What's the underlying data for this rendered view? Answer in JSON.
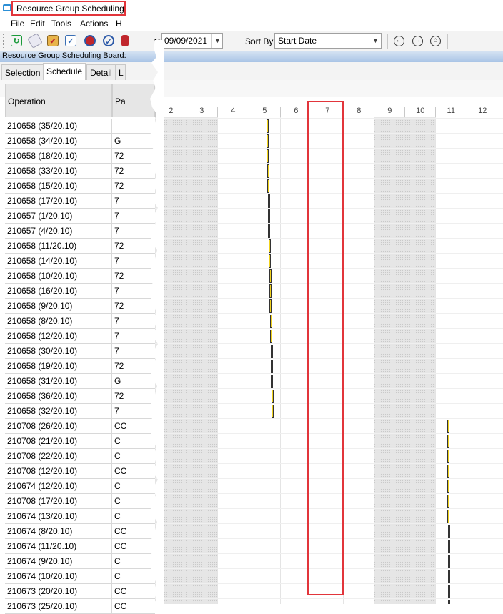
{
  "window": {
    "title": "Resource Group Scheduling Board"
  },
  "menu": [
    "File",
    "Edit",
    "Tools",
    "Actions",
    "H"
  ],
  "toolbar": {
    "icons": [
      "refresh-icon",
      "eraser-icon",
      "clipboard-icon",
      "checklist-icon",
      "schedule-icon",
      "approve-icon"
    ],
    "date_label_fragment": "to",
    "date_value": "09/09/2021",
    "sort_label": "Sort By",
    "sort_value": "Start Date",
    "nav_icons": [
      "back-icon",
      "forward-icon",
      "home-icon"
    ]
  },
  "board_title": "Resource Group Scheduling Board:",
  "tabs": [
    "Selection",
    "Schedule",
    "Detail",
    "L"
  ],
  "active_tab": "Schedule",
  "grid": {
    "headers": {
      "operation": "Operation",
      "part": "Pa"
    },
    "rows": [
      {
        "op": "210658 (35/20.10)",
        "part": ""
      },
      {
        "op": "210658 (34/20.10)",
        "part": "G"
      },
      {
        "op": "210658 (18/20.10)",
        "part": "72"
      },
      {
        "op": "210658 (33/20.10)",
        "part": "72"
      },
      {
        "op": "210658 (15/20.10)",
        "part": "72"
      },
      {
        "op": "210658 (17/20.10)",
        "part": "7"
      },
      {
        "op": "210657 (1/20.10)",
        "part": "7"
      },
      {
        "op": "210657 (4/20.10)",
        "part": "7"
      },
      {
        "op": "210658 (11/20.10)",
        "part": "72"
      },
      {
        "op": "210658 (14/20.10)",
        "part": "7"
      },
      {
        "op": "210658 (10/20.10)",
        "part": "72"
      },
      {
        "op": "210658 (16/20.10)",
        "part": "7"
      },
      {
        "op": "210658 (9/20.10)",
        "part": "72"
      },
      {
        "op": "210658 (8/20.10)",
        "part": "7"
      },
      {
        "op": "210658 (12/20.10)",
        "part": "7"
      },
      {
        "op": "210658 (30/20.10)",
        "part": "7"
      },
      {
        "op": "210658 (19/20.10)",
        "part": "72"
      },
      {
        "op": "210658 (31/20.10)",
        "part": "G"
      },
      {
        "op": "210658 (36/20.10)",
        "part": "72"
      },
      {
        "op": "210658 (32/20.10)",
        "part": "7"
      },
      {
        "op": "210708 (26/20.10)",
        "part": "CC"
      },
      {
        "op": "210708 (21/20.10)",
        "part": "C"
      },
      {
        "op": "210708 (22/20.10)",
        "part": "C"
      },
      {
        "op": "210708 (12/20.10)",
        "part": "CC"
      },
      {
        "op": "210674 (12/20.10)",
        "part": "C"
      },
      {
        "op": "210708 (17/20.10)",
        "part": "C"
      },
      {
        "op": "210674 (13/20.10)",
        "part": "C"
      },
      {
        "op": "210674 (8/20.10)",
        "part": "CC"
      },
      {
        "op": "210674 (11/20.10)",
        "part": "CC"
      },
      {
        "op": "210674 (9/20.10)",
        "part": "C"
      },
      {
        "op": "210674 (10/20.10)",
        "part": "C"
      },
      {
        "op": "210673 (20/20.10)",
        "part": "CC"
      },
      {
        "op": "210673 (25/20.10)",
        "part": "CC"
      }
    ]
  },
  "gantt": {
    "days": [
      "2",
      "3",
      "4",
      "5",
      "6",
      "7",
      "8",
      "9",
      "10",
      "11",
      "12"
    ],
    "weekend_days": [
      "2",
      "3",
      "9",
      "10"
    ],
    "highlighted_day": "7",
    "colors": {
      "bar_fill": "#f1d21d",
      "bar_border": "#333333",
      "highlight": "#e2353b"
    }
  }
}
